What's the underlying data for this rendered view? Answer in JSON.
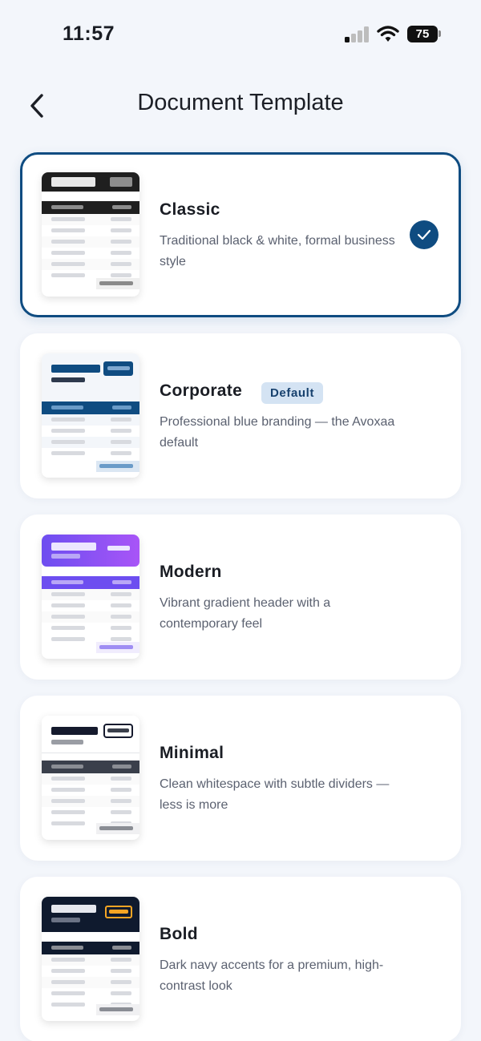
{
  "status": {
    "time": "11:57",
    "battery": "75"
  },
  "header": {
    "title": "Document Template"
  },
  "templates": [
    {
      "name": "Classic",
      "badge": "",
      "desc": "Traditional black & white, formal business style",
      "selected": true,
      "accent": "#1f1f1f",
      "table_header": "#1f1f1f",
      "total_bar": "#8a8a8a"
    },
    {
      "name": "Corporate",
      "badge": "Default",
      "desc": "Professional blue branding — the Avoxaa default",
      "selected": false,
      "accent": "#0f4c81",
      "table_header": "#0f4c81",
      "total_bar": "#6a9bc8"
    },
    {
      "name": "Modern",
      "badge": "",
      "desc": "Vibrant gradient header with a contemporary feel",
      "selected": false,
      "accent": "#7c3aed",
      "table_header": "#6d4ef0",
      "total_bar": "#9f8df3"
    },
    {
      "name": "Minimal",
      "badge": "",
      "desc": "Clean whitespace with subtle dividers — less is more",
      "selected": false,
      "accent": "#151a2d",
      "table_header": "#3a3f4b",
      "total_bar": "#8a8d94"
    },
    {
      "name": "Bold",
      "badge": "",
      "desc": "Dark navy accents for a premium, high-contrast look",
      "selected": false,
      "accent": "#0f1a2e",
      "table_header": "#0f1a2e",
      "total_bar": "#8a8d94"
    }
  ]
}
